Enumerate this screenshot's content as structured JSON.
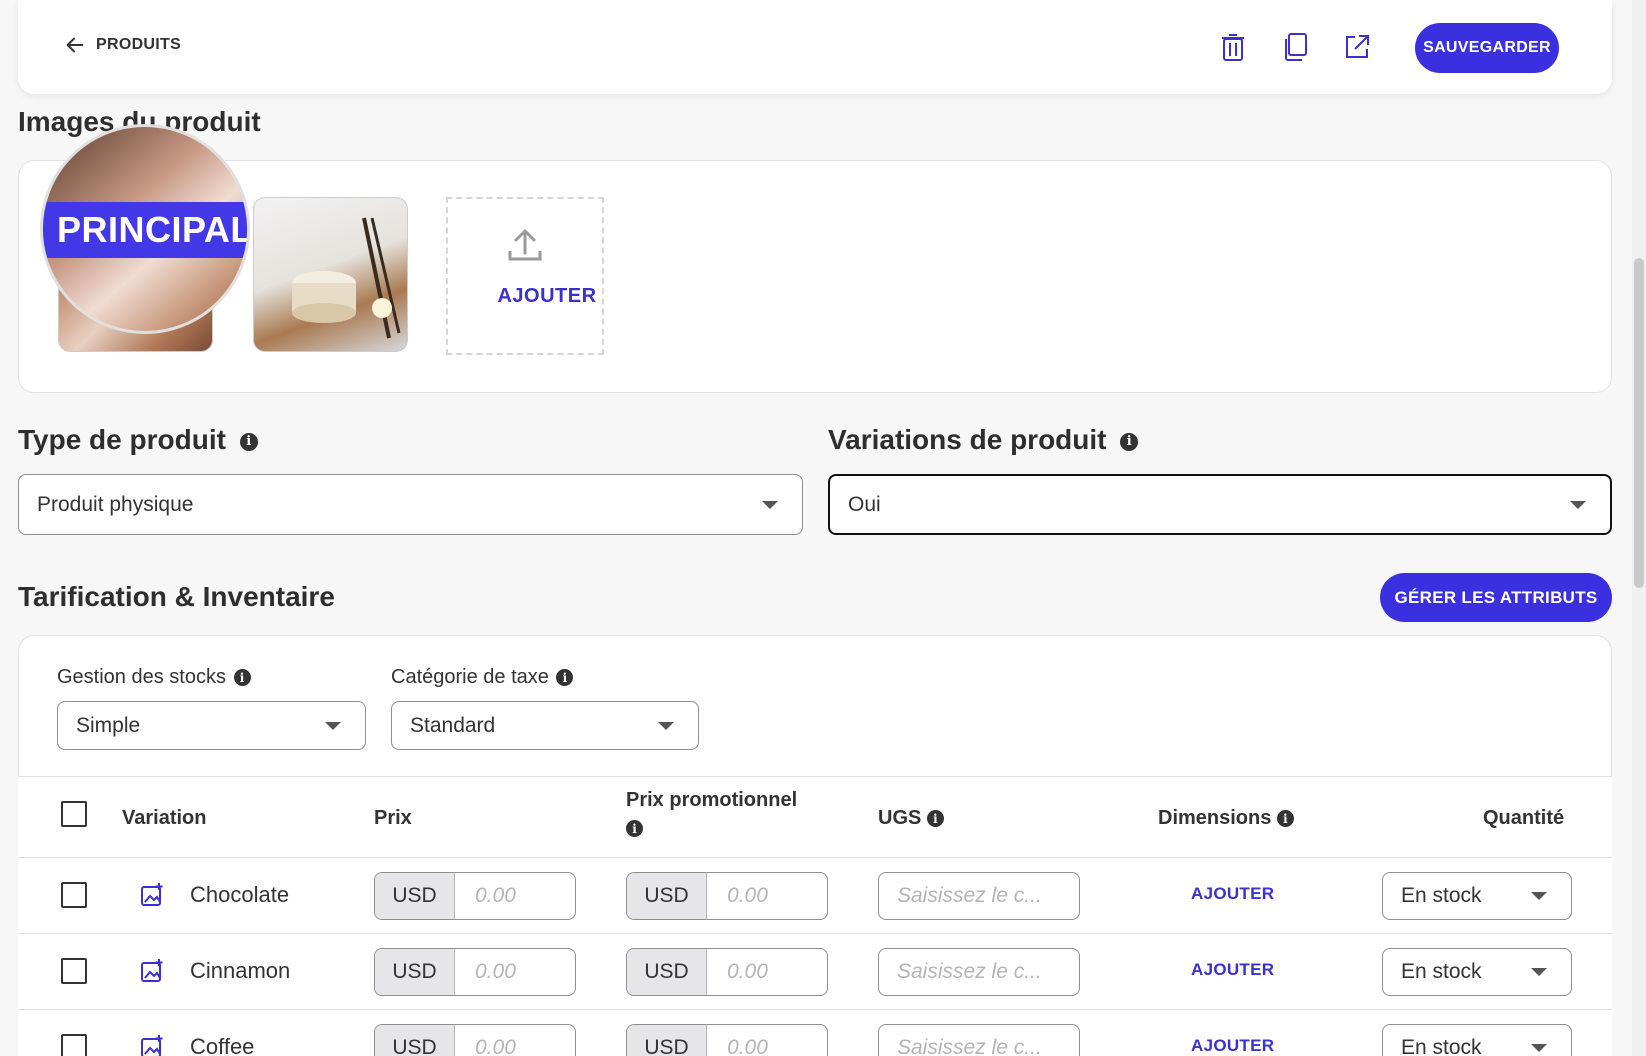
{
  "header": {
    "back_label": "PRODUITS",
    "save_label": "SAUVEGARDER"
  },
  "images_section": {
    "title": "Images du produit",
    "principal_badge": "PRINCIPAL",
    "add_label": "AJOUTER"
  },
  "product_type": {
    "title": "Type de produit",
    "value": "Produit physique"
  },
  "variations": {
    "title": "Variations de produit",
    "value": "Oui"
  },
  "pricing": {
    "title": "Tarification & Inventaire",
    "manage_attributes_label": "GÉRER LES ATTRIBUTS",
    "stock_management": {
      "label": "Gestion des stocks",
      "value": "Simple"
    },
    "tax_category": {
      "label": "Catégorie de taxe",
      "value": "Standard"
    }
  },
  "table": {
    "headers": {
      "variation": "Variation",
      "price": "Prix",
      "promo_price": "Prix promotionnel",
      "sku": "UGS",
      "dimensions": "Dimensions",
      "quantity": "Quantité"
    },
    "rows": [
      {
        "name": "Chocolate",
        "currency": "USD",
        "price_placeholder": "0.00",
        "promo_currency": "USD",
        "promo_placeholder": "0.00",
        "sku_placeholder": "Saisissez le c...",
        "dimensions_link": "AJOUTER",
        "quantity": "En stock"
      },
      {
        "name": "Cinnamon",
        "currency": "USD",
        "price_placeholder": "0.00",
        "promo_currency": "USD",
        "promo_placeholder": "0.00",
        "sku_placeholder": "Saisissez le c...",
        "dimensions_link": "AJOUTER",
        "quantity": "En stock"
      },
      {
        "name": "Coffee",
        "currency": "USD",
        "price_placeholder": "0.00",
        "promo_currency": "USD",
        "promo_placeholder": "0.00",
        "sku_placeholder": "Saisissez le c...",
        "dimensions_link": "AJOUTER",
        "quantity": "En stock"
      }
    ]
  },
  "icons": {
    "back": "arrow-left-icon",
    "delete": "trash-icon",
    "duplicate": "copy-icon",
    "open": "external-link-icon",
    "upload": "upload-icon",
    "info": "info-icon",
    "variation_image": "add-image-icon"
  },
  "colors": {
    "accent": "#3b30e0",
    "link": "#3b30d0",
    "badge": "#4338e6"
  }
}
